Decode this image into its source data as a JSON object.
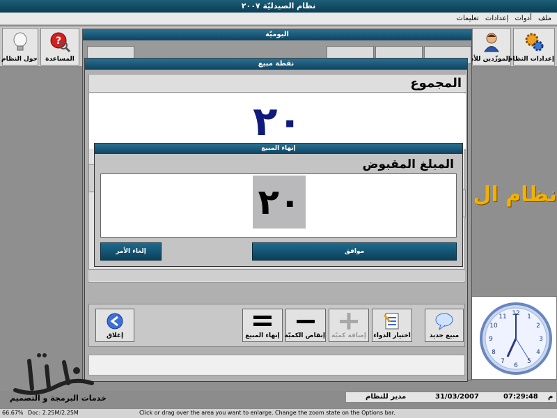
{
  "app": {
    "title": "نظام الصيدليّة ٢٠٠٧"
  },
  "menu": [
    "ملف",
    "أدوات",
    "إعدادات",
    "تعليمات"
  ],
  "toolbar": {
    "about_label": "حول النظام",
    "help_label": "المساعدة",
    "suppliers_label": "الموزّدين للأدو",
    "settings_label": "إعدادات النظام"
  },
  "daily_window": {
    "title": "اليوميّة"
  },
  "brand_text": "نظام ال",
  "sale_window": {
    "title": "نقطة مبيع",
    "total_label": "المجموع",
    "total_value": "٢٠",
    "buttons": {
      "close": "إغلاق",
      "finish_sale": "إنهاء المبيع",
      "decrease_qty": "إنقاص الكميّة",
      "increase_qty": "إضافة كميّة",
      "choose_drug": "اختيار الدواء",
      "new_sale": "مبيع جديد"
    }
  },
  "finish_dialog": {
    "title": "إنهاء المبيع",
    "amount_label": "المبلغ المقبوض",
    "amount_value": "٢٠",
    "ok_label": "موافق",
    "cancel_label": "إلغاء الأمر"
  },
  "logo": {
    "tagline": "خدمات البرمجة و التصميم"
  },
  "status": {
    "user": "مدير للنظام",
    "date": "31/03/2007",
    "time": "07:29:48",
    "time_suffix": "م"
  },
  "doc_status": {
    "zoom": "66.67%",
    "doc": "Doc: 2.25M/2.25M",
    "hint": "Click or drag over the area you want to enlarge. Change the zoom state on the Options bar."
  },
  "colors": {
    "title_bar": "#0f4360",
    "total_value": "#0f1a7a",
    "brand": "#f2b100"
  }
}
